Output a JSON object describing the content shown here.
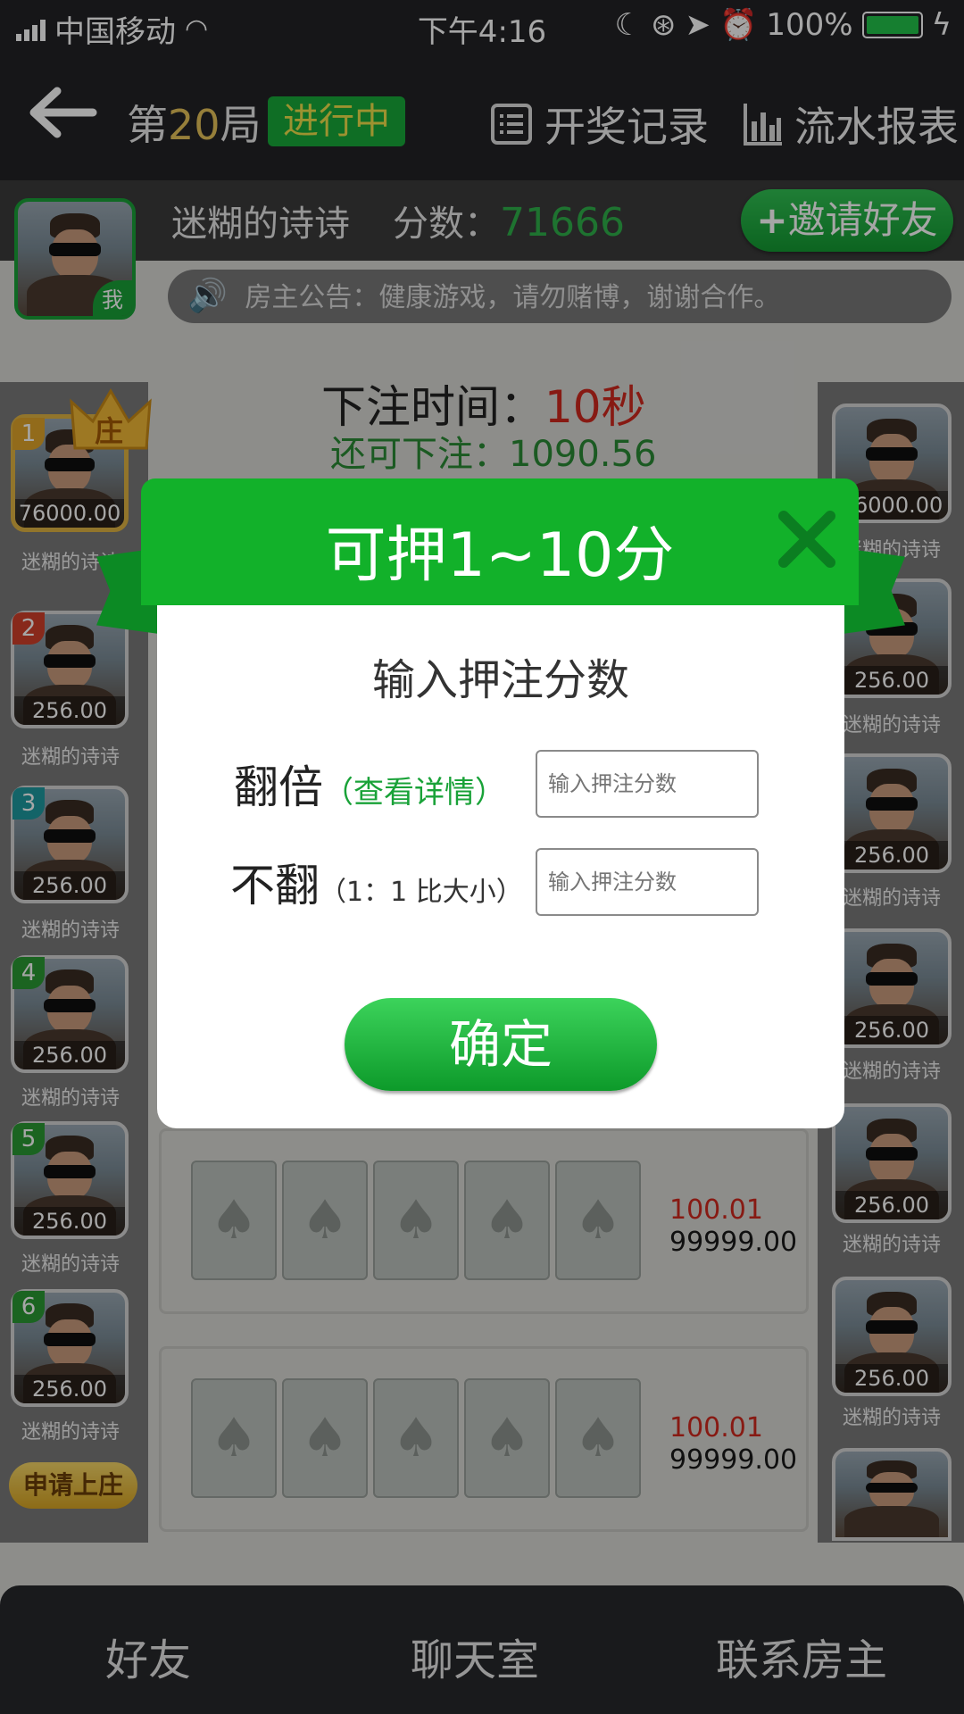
{
  "status_bar": {
    "carrier": "中国移动",
    "time": "下午4:16",
    "battery": "100%"
  },
  "header": {
    "round_prefix": "第",
    "round_number": "20",
    "round_suffix": "局",
    "round_status": "进行中",
    "history_label": "开奖记录",
    "report_label": "流水报表"
  },
  "user": {
    "name": "迷糊的诗诗",
    "score_label": "分数：",
    "score_value": "71666",
    "me_tag": "我",
    "invite_label": "邀请好友"
  },
  "notice": {
    "text": "房主公告：健康游戏，请勿赌博，谢谢合作。"
  },
  "betting": {
    "time_label": "下注时间：",
    "time_value": "10秒",
    "remaining_label": "还可下注：1090.56"
  },
  "left_players": [
    {
      "rank": "1",
      "amount": "76000.00",
      "name": "迷糊的诗诗",
      "banker_tag": "庄"
    },
    {
      "rank": "2",
      "amount": "256.00",
      "name": "迷糊的诗诗"
    },
    {
      "rank": "3",
      "amount": "256.00",
      "name": "迷糊的诗诗"
    },
    {
      "rank": "4",
      "amount": "256.00",
      "name": "迷糊的诗诗"
    },
    {
      "rank": "5",
      "amount": "256.00",
      "name": "迷糊的诗诗"
    },
    {
      "rank": "6",
      "amount": "256.00",
      "name": "迷糊的诗诗"
    }
  ],
  "apply_banker_label": "申请上庄",
  "right_players": [
    {
      "amount": "76000.00",
      "name": "迷糊的诗诗"
    },
    {
      "amount": "256.00",
      "name": "迷糊的诗诗"
    },
    {
      "amount": "256.00",
      "name": "迷糊的诗诗"
    },
    {
      "amount": "256.00",
      "name": "迷糊的诗诗"
    },
    {
      "amount": "256.00",
      "name": "迷糊的诗诗"
    },
    {
      "amount": "256.00",
      "name": "迷糊的诗诗"
    }
  ],
  "hands": [
    {
      "bet_red": "100.01",
      "bet_black": "99999.00"
    },
    {
      "bet_red": "100.01",
      "bet_black": "99999.00"
    }
  ],
  "footer": {
    "tab1": "好友",
    "tab2": "聊天室",
    "tab3": "联系房主"
  },
  "modal": {
    "title": "可押1~10分",
    "subtitle": "输入押注分数",
    "double_label": "翻倍",
    "double_note": "（查看详情）",
    "double_placeholder": "输入押注分数",
    "single_label": "不翻",
    "single_note": "（1：1 比大小）",
    "single_placeholder": "输入押注分数",
    "confirm_label": "确定"
  },
  "colors": {
    "accent_green": "#12b12a",
    "score_green": "#2fb14a",
    "countdown_red": "#d0281e",
    "round_gold": "#e7c35a"
  }
}
